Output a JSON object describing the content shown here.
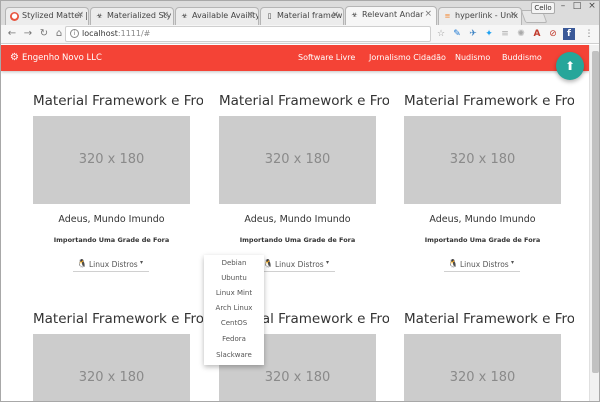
{
  "browser": {
    "tabs": [
      {
        "title": "Stylized Matter |",
        "icon": "globe-icon"
      },
      {
        "title": "Materialized Sty",
        "icon": "biohazard-icon"
      },
      {
        "title": "Available Availity",
        "icon": "biohazard-icon"
      },
      {
        "title": "Material framew",
        "icon": "document-icon"
      },
      {
        "title": "Relevant Andar",
        "icon": "biohazard-icon"
      },
      {
        "title": "hyperlink - Unix",
        "icon": "stackexchange-icon"
      }
    ],
    "profile_label": "Cello",
    "url_host": "localhost",
    "url_rest": ":1111/#"
  },
  "app": {
    "brand": "Engenho Novo LLC",
    "nav": [
      "Software Livre",
      "Jornalismo Cidadão",
      "Nudismo",
      "Buddismo"
    ],
    "fab_icon": "upload-icon",
    "accent": "#f44336",
    "fab_color": "#26a69a"
  },
  "cards": [
    {
      "title": "Material Framework e Frow",
      "image": "320 x 180",
      "subtitle": "Adeus, Mundo Imundo",
      "text": "Importando Uma Grade de Fora",
      "dropdown": "Linux Distros"
    },
    {
      "title": "Material Framework e Frow",
      "image": "320 x 180",
      "subtitle": "Adeus, Mundo Imundo",
      "text": "Importando Uma Grade de Fora",
      "dropdown": "Linux Distros"
    },
    {
      "title": "Material Framework e Frow",
      "image": "320 x 180",
      "subtitle": "Adeus, Mundo Imundo",
      "text": "Importando Uma Grade de Fora",
      "dropdown": "Linux Distros"
    },
    {
      "title": "Material Framework e Frow",
      "image": "320 x 180"
    },
    {
      "title": "Material Framework e Frow",
      "image": "320 x 180"
    },
    {
      "title": "Material Framework e Frow",
      "image": "320 x 180"
    }
  ],
  "dropdown_menu": [
    "Debian",
    "Ubuntu",
    "Linux Mint",
    "Arch Linux",
    "CentOS",
    "Fedora",
    "Slackware"
  ]
}
